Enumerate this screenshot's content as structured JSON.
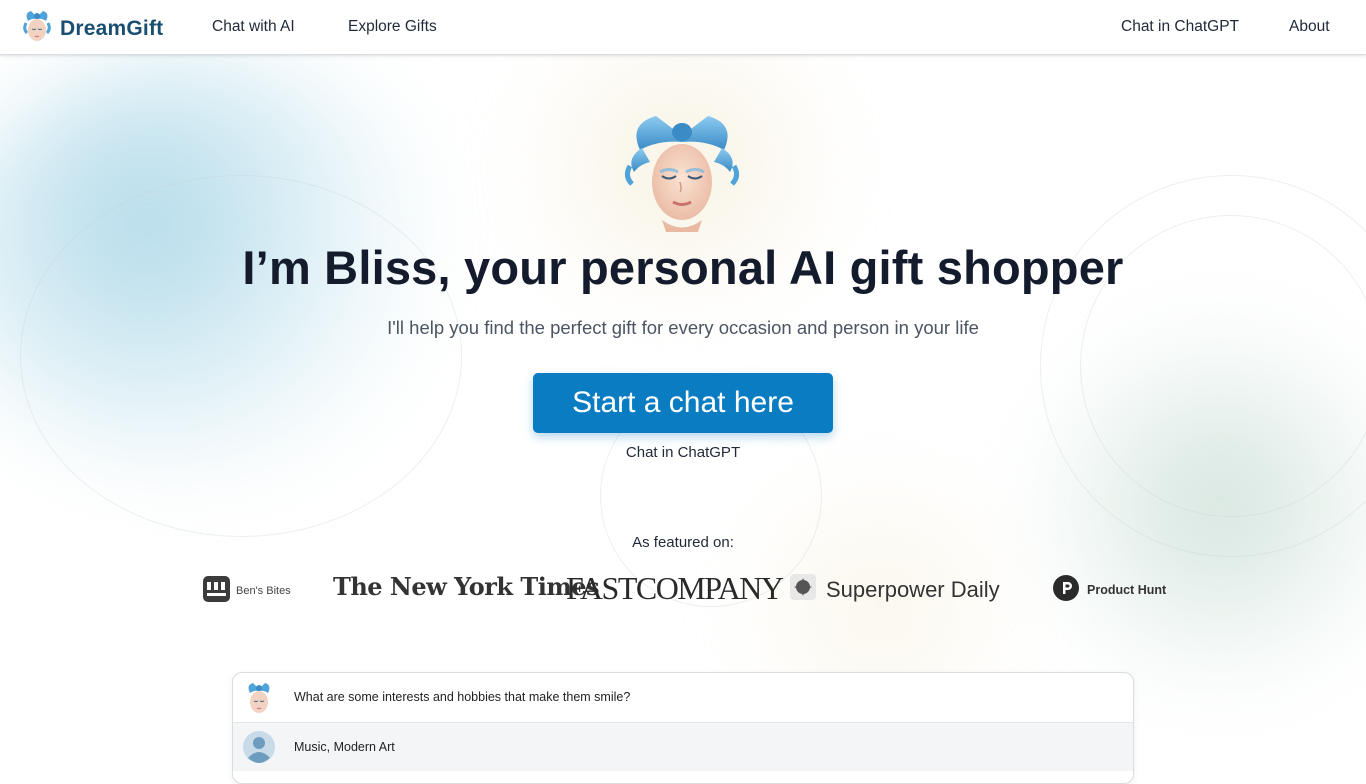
{
  "header": {
    "brand_name": "DreamGift",
    "nav_left": [
      "Chat with AI",
      "Explore Gifts"
    ],
    "nav_right": [
      "Chat in ChatGPT",
      "About"
    ]
  },
  "hero": {
    "title": "I’m Bliss, your personal AI gift shopper",
    "subtitle": "I'll help you find the perfect gift for every occasion and person in your life",
    "cta_label": "Start a chat here",
    "cta_secondary": "Chat in ChatGPT"
  },
  "featured": {
    "label": "As featured on:",
    "logos": [
      "Ben's Bites",
      "The New York Times",
      "FASTCOMPANY",
      "Superpower Daily",
      "Product Hunt"
    ]
  },
  "chat_preview": {
    "messages": [
      {
        "role": "assistant",
        "text": "What are some interests and hobbies that make them smile?"
      },
      {
        "role": "user",
        "text": "Music, Modern Art"
      }
    ]
  },
  "colors": {
    "brand": "#1b4f72",
    "cta": "#0a7cc2",
    "bow": "#4fa3d9"
  },
  "icons": {
    "brand_logo": "bliss-avatar-icon",
    "hero_avatar": "bliss-avatar-icon",
    "user_avatar": "user-avatar-icon"
  }
}
